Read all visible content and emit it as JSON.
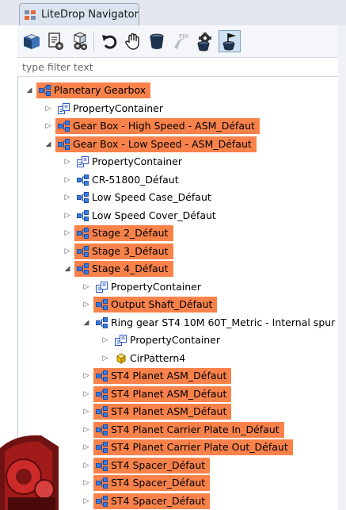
{
  "window": {
    "tab_title": "LiteDrop Navigator"
  },
  "toolbar": {
    "buttons": [
      {
        "name": "open-3d-button",
        "icon": "box-open-icon"
      },
      {
        "name": "properties-button",
        "icon": "document-gear-icon"
      },
      {
        "name": "parts-settings-button",
        "icon": "cube-gear-icon"
      },
      {
        "name": "undo-button",
        "icon": "undo-icon"
      },
      {
        "name": "hand-button",
        "icon": "hand-icon"
      },
      {
        "name": "container-button",
        "icon": "bucket-icon"
      },
      {
        "name": "pmi-button",
        "icon": "pmi-icon",
        "label": "PMI"
      },
      {
        "name": "filter-settings-button",
        "icon": "gear-filter-icon"
      },
      {
        "name": "flag-drop-button",
        "icon": "flag-bucket-icon",
        "selected": true
      }
    ]
  },
  "filter": {
    "placeholder": "type filter text"
  },
  "tree": {
    "highlight_color": "#f9824b",
    "rows": [
      {
        "label": "Planetary Gearbox",
        "level": 0,
        "toggle": "expanded",
        "icon": "assembly-icon",
        "highlighted": true
      },
      {
        "label": "PropertyContainer",
        "level": 1,
        "toggle": "collapsed",
        "icon": "property-container-icon",
        "highlighted": false
      },
      {
        "label": "Gear Box - High Speed - ASM_Défaut",
        "level": 1,
        "toggle": "collapsed",
        "icon": "assembly-icon",
        "highlighted": true
      },
      {
        "label": "Gear Box - Low Speed - ASM_Défaut",
        "level": 1,
        "toggle": "expanded",
        "icon": "assembly-icon",
        "highlighted": true
      },
      {
        "label": "PropertyContainer",
        "level": 2,
        "toggle": "collapsed",
        "icon": "property-container-icon",
        "highlighted": false
      },
      {
        "label": "CR-51800_Défaut",
        "level": 2,
        "toggle": "collapsed",
        "icon": "assembly-icon",
        "highlighted": false
      },
      {
        "label": "Low Speed Case_Défaut",
        "level": 2,
        "toggle": "collapsed",
        "icon": "assembly-icon",
        "highlighted": false
      },
      {
        "label": "Low Speed Cover_Défaut",
        "level": 2,
        "toggle": "collapsed",
        "icon": "assembly-icon",
        "highlighted": false
      },
      {
        "label": "Stage 2_Défaut",
        "level": 2,
        "toggle": "collapsed",
        "icon": "assembly-icon",
        "highlighted": true
      },
      {
        "label": "Stage 3_Défaut",
        "level": 2,
        "toggle": "collapsed",
        "icon": "assembly-icon",
        "highlighted": true
      },
      {
        "label": "Stage 4_Défaut",
        "level": 2,
        "toggle": "expanded",
        "icon": "assembly-icon",
        "highlighted": true
      },
      {
        "label": "PropertyContainer",
        "level": 3,
        "toggle": "collapsed",
        "icon": "property-container-icon",
        "highlighted": false
      },
      {
        "label": "Output Shaft_Défaut",
        "level": 3,
        "toggle": "collapsed",
        "icon": "assembly-icon",
        "highlighted": true
      },
      {
        "label": "Ring gear ST4 10M 60T_Metric - Internal spur",
        "level": 3,
        "toggle": "expanded",
        "icon": "assembly-icon",
        "highlighted": false
      },
      {
        "label": "PropertyContainer",
        "level": 4,
        "toggle": "collapsed",
        "icon": "property-container-icon",
        "highlighted": false
      },
      {
        "label": "CirPattern4",
        "level": 4,
        "toggle": "collapsed",
        "icon": "feature-cube-icon",
        "highlighted": false
      },
      {
        "label": "ST4 Planet ASM_Défaut",
        "level": 3,
        "toggle": "collapsed",
        "icon": "assembly-icon",
        "highlighted": true
      },
      {
        "label": "ST4 Planet ASM_Défaut",
        "level": 3,
        "toggle": "collapsed",
        "icon": "assembly-icon",
        "highlighted": true
      },
      {
        "label": "ST4 Planet ASM_Défaut",
        "level": 3,
        "toggle": "collapsed",
        "icon": "assembly-icon",
        "highlighted": true
      },
      {
        "label": "ST4 Planet Carrier Plate In_Défaut",
        "level": 3,
        "toggle": "collapsed",
        "icon": "assembly-icon",
        "highlighted": true
      },
      {
        "label": "ST4 Planet Carrier Plate Out_Défaut",
        "level": 3,
        "toggle": "collapsed",
        "icon": "assembly-icon",
        "highlighted": true
      },
      {
        "label": "ST4 Spacer_Défaut",
        "level": 3,
        "toggle": "collapsed",
        "icon": "assembly-icon",
        "highlighted": true
      },
      {
        "label": "ST4 Spacer_Défaut",
        "level": 3,
        "toggle": "collapsed",
        "icon": "assembly-icon",
        "highlighted": true
      },
      {
        "label": "ST4 Spacer_Défaut",
        "level": 3,
        "toggle": "collapsed",
        "icon": "assembly-icon",
        "highlighted": true
      }
    ]
  }
}
